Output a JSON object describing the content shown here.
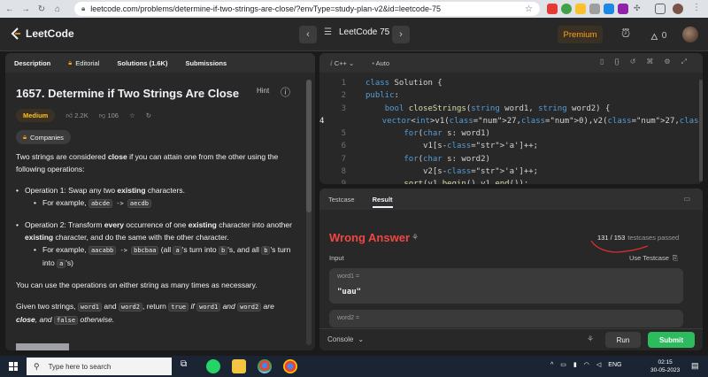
{
  "browser": {
    "url": "leetcode.com/problems/determine-if-two-strings-are-close/?envType=study-plan-v2&id=leetcode-75"
  },
  "nav": {
    "logo_text": "LeetCode",
    "study_plan": "LeetCode 75",
    "premium_label": "Premium",
    "streak_count": "0"
  },
  "tabs": {
    "description": "Description",
    "editorial": "Editorial",
    "solutions": "Solutions (1.6K)",
    "submissions": "Submissions"
  },
  "problem": {
    "title": "1657. Determine if Two Strings Are Close",
    "hint_label": "Hint",
    "difficulty": "Medium",
    "likes": "2.2K",
    "dislikes": "106",
    "companies_label": "Companies",
    "intro_1": "Two strings are considered ",
    "intro_bold": "close",
    "intro_2": " if you can attain one from the other using the following operations:",
    "op1_a": "Operation 1: Swap any two ",
    "op1_bold": "existing",
    "op1_b": " characters.",
    "op1_ex_prefix": "For example, ",
    "op1_ex_code_1": "abcde",
    "op1_ex_arrow": " -> ",
    "op1_ex_code_2": "aecdb",
    "op2_a": "Operation 2: Transform ",
    "op2_bold_1": "every",
    "op2_b": " occurrence of one ",
    "op2_bold_2": "existing",
    "op2_c": " character into another ",
    "op2_bold_3": "existing",
    "op2_d": " character, and do the same with the other character.",
    "op2_ex_prefix": "For example, ",
    "op2_ex_code_1": "aacabb",
    "op2_ex_arrow": " -> ",
    "op2_ex_code_2": "bbcbaa",
    "op2_ex_mid_1": " (all ",
    "op2_ex_code_a": "a",
    "op2_ex_mid_2": "'s turn into ",
    "op2_ex_code_b": "b",
    "op2_ex_mid_3": "'s, and all ",
    "op2_ex_code_b2": "b",
    "op2_ex_mid_4": "'s turn into ",
    "op2_ex_code_a2": "a",
    "op2_ex_end": "'s)",
    "para_ops": "You can use the operations on either string as many times as necessary.",
    "given_1": "Given two strings, ",
    "given_code_1": "word1",
    "given_2": " and ",
    "given_code_2": "word2",
    "given_3": ", return ",
    "given_code_3": "true",
    "given_4": " if ",
    "given_code_4": "word1",
    "given_5": " and ",
    "given_code_5": "word2",
    "given_6": " are ",
    "given_bold": "close",
    "given_7": ", and ",
    "given_code_6": "false",
    "given_8": " otherwise."
  },
  "editor": {
    "language": "C++",
    "mode": "Auto",
    "lines": [
      {
        "n": "1",
        "code": "class Solution {"
      },
      {
        "n": "2",
        "code": "public:"
      },
      {
        "n": "3",
        "code": "    bool closeStrings(string word1, string word2) {"
      },
      {
        "n": "4",
        "code": "        vector<int>v1(27,0),v2(27,0);"
      },
      {
        "n": "5",
        "code": "        for(char s: word1)"
      },
      {
        "n": "6",
        "code": "            v1[s-'a']++;"
      },
      {
        "n": "7",
        "code": "        for(char s: word2)"
      },
      {
        "n": "8",
        "code": "            v2[s-'a']++;"
      },
      {
        "n": "9",
        "code": "        sort(v1.begin(),v1.end());"
      }
    ]
  },
  "result": {
    "tab_testcase": "Testcase",
    "tab_result": "Result",
    "verdict": "Wrong Answer",
    "passed": "131 / 153",
    "passed_suffix": "testcases passed",
    "input_label": "Input",
    "use_testcase": "Use Testcase",
    "var1_name": "word1 =",
    "var1_value": "\"uau\"",
    "var2_name": "word2 ="
  },
  "bottom": {
    "console_label": "Console",
    "run_label": "Run",
    "submit_label": "Submit"
  },
  "taskbar": {
    "search_placeholder": "Type here to search",
    "lang": "ENG",
    "time": "02:15",
    "date": "30-05-2023"
  },
  "colors": {
    "accent": "#ffa116",
    "wrong": "#ef4743",
    "submit": "#2cbb5d",
    "medium": "#ffc01e"
  }
}
